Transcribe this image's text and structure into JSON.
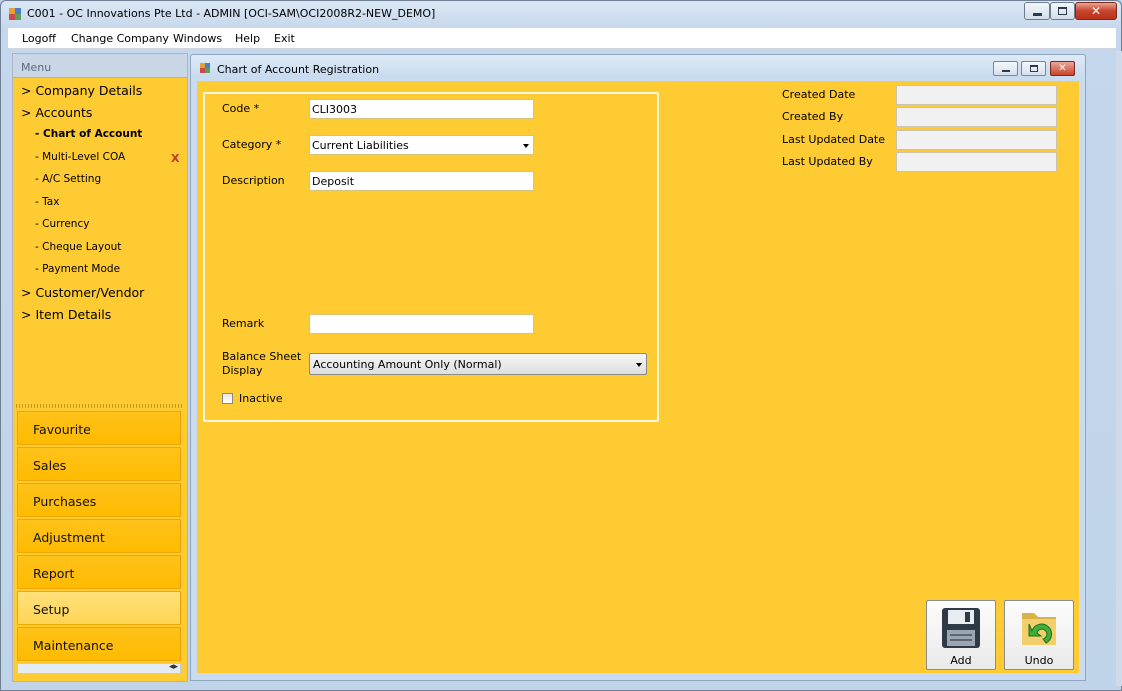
{
  "window": {
    "title": "C001 - OC Innovations Pte Ltd - ADMIN [OCI-SAM\\OCI2008R2-NEW_DEMO]",
    "icon": "app-icon"
  },
  "menubar": [
    "Logoff",
    "Change Company",
    "Windows",
    "Help",
    "Exit"
  ],
  "sidebar": {
    "header": "Menu",
    "tree": [
      {
        "label": "> Company Details",
        "level": 1
      },
      {
        "label": "> Accounts",
        "level": 1
      },
      {
        "label": "- Chart of Account",
        "level": 2,
        "active": true
      },
      {
        "label": "- Multi-Level COA",
        "level": 2
      },
      {
        "label": "- A/C Setting",
        "level": 2
      },
      {
        "label": "- Tax",
        "level": 2
      },
      {
        "label": "- Currency",
        "level": 2
      },
      {
        "label": "- Cheque Layout",
        "level": 2
      },
      {
        "label": "- Payment Mode",
        "level": 2
      },
      {
        "label": "> Customer/Vendor",
        "level": 1
      },
      {
        "label": "> Item Details",
        "level": 1
      }
    ],
    "close_mark": "X",
    "nav_buttons": [
      {
        "label": "Favourite"
      },
      {
        "label": "Sales"
      },
      {
        "label": "Purchases"
      },
      {
        "label": "Adjustment"
      },
      {
        "label": "Report"
      },
      {
        "label": "Setup",
        "active": true
      },
      {
        "label": "Maintenance"
      }
    ],
    "scroll_glyph": "◂▸"
  },
  "child_window": {
    "title": "Chart of Account Registration"
  },
  "form": {
    "code_label": "Code *",
    "code_value": "CLI3003",
    "category_label": "Category *",
    "category_value": "Current Liabilities",
    "description_label": "Description",
    "description_value": "Deposit",
    "remark_label": "Remark",
    "remark_value": "",
    "balance_label_1": "Balance Sheet",
    "balance_label_2": "Display",
    "balance_value": "Accounting Amount Only (Normal)",
    "inactive_label": "Inactive",
    "inactive_checked": false
  },
  "audit": {
    "created_date_label": "Created Date",
    "created_by_label": "Created By",
    "last_updated_date_label": "Last Updated Date",
    "last_updated_by_label": "Last Updated By"
  },
  "buttons": {
    "add_label": "Add",
    "undo_label": "Undo"
  },
  "colors": {
    "panel": "#ffcb33",
    "nav_button": "#ffbb00",
    "title_close": "#c8432b"
  }
}
